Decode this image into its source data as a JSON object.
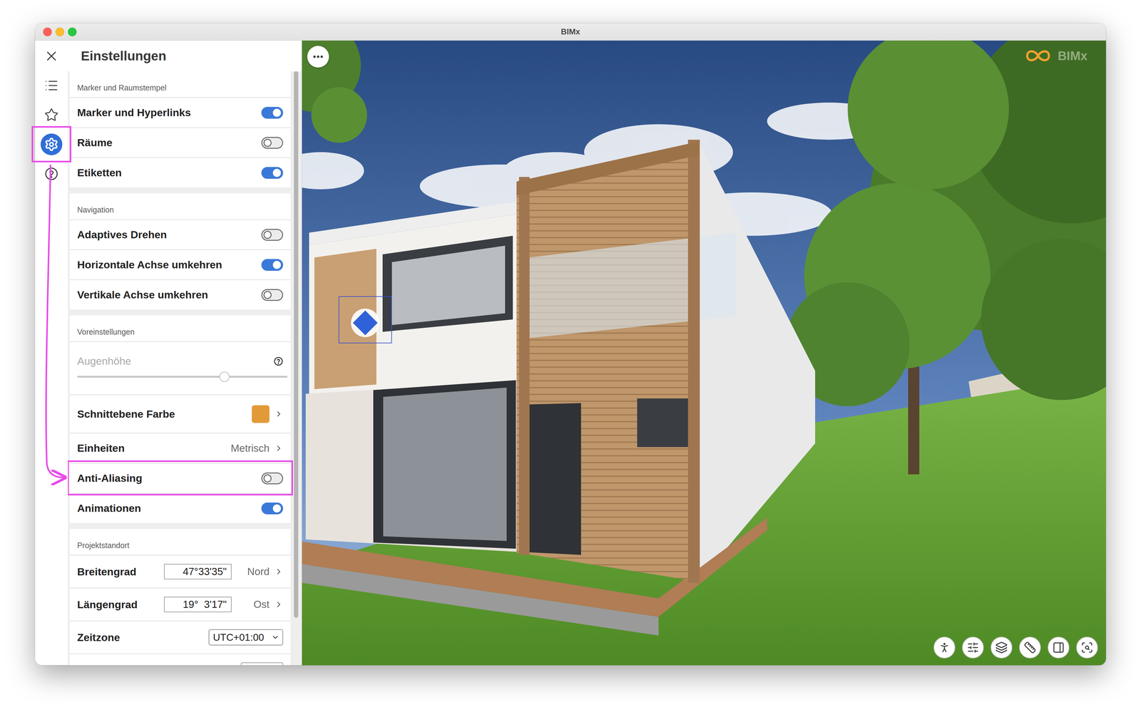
{
  "window": {
    "title": "BIMx"
  },
  "panel": {
    "title": "Einstellungen",
    "scroll_level": 0.92
  },
  "rail": [
    {
      "kind": "close",
      "selected": false,
      "highlighted": false
    },
    {
      "kind": "list",
      "selected": false,
      "highlighted": false
    },
    {
      "kind": "favorites",
      "selected": false,
      "highlighted": false
    },
    {
      "kind": "settings",
      "selected": true,
      "highlighted": true
    },
    {
      "kind": "help",
      "selected": false,
      "highlighted": false
    }
  ],
  "sections": [
    {
      "title": "Marker und Raumstempel",
      "rows": [
        {
          "kind": "toggle",
          "label": "Marker und Hyperlinks",
          "on": true,
          "highlighted": false
        },
        {
          "kind": "toggle",
          "label": "Räume",
          "on": false,
          "highlighted": false
        },
        {
          "kind": "toggle",
          "label": "Etiketten",
          "on": true,
          "highlighted": false
        }
      ]
    },
    {
      "title": "Navigation",
      "rows": [
        {
          "kind": "toggle",
          "label": "Adaptives Drehen",
          "on": false,
          "highlighted": false
        },
        {
          "kind": "toggle",
          "label": "Horizontale Achse umkehren",
          "on": true,
          "highlighted": false
        },
        {
          "kind": "toggle",
          "label": "Vertikale Achse umkehren",
          "on": false,
          "highlighted": false
        }
      ]
    },
    {
      "title": "Voreinstellungen",
      "rows": [
        {
          "kind": "slider",
          "label": "Augenhöhe",
          "level": 0.7,
          "disabled": true,
          "highlighted": false
        },
        {
          "kind": "color",
          "label": "Schnittebene Farbe",
          "color": "#e29a38",
          "highlighted": false
        },
        {
          "kind": "value",
          "label": "Einheiten",
          "value": "Metrisch",
          "highlighted": false
        },
        {
          "kind": "toggle",
          "label": "Anti-Aliasing",
          "on": false,
          "highlighted": true
        },
        {
          "kind": "toggle",
          "label": "Animationen",
          "on": true,
          "highlighted": false
        }
      ]
    },
    {
      "title": "Projektstandort",
      "rows": [
        {
          "kind": "coordinate",
          "label": "Breitengrad",
          "value": "47°33'35\"",
          "hemisphere": "Nord",
          "highlighted": false
        },
        {
          "kind": "coordinate",
          "label": "Längengrad",
          "value": "19°  3'17\"",
          "hemisphere": "Ost",
          "highlighted": false
        },
        {
          "kind": "select",
          "label": "Zeitzone",
          "value": "UTC+01:00",
          "highlighted": false
        },
        {
          "kind": "field",
          "label": "",
          "value": "",
          "highlighted": false
        }
      ]
    }
  ],
  "viewport": {
    "logo": "BIMx",
    "tools": [
      {
        "kind": "walk"
      },
      {
        "kind": "view-settings"
      },
      {
        "kind": "layers"
      },
      {
        "kind": "measure"
      },
      {
        "kind": "documents"
      },
      {
        "kind": "zoom"
      }
    ]
  }
}
